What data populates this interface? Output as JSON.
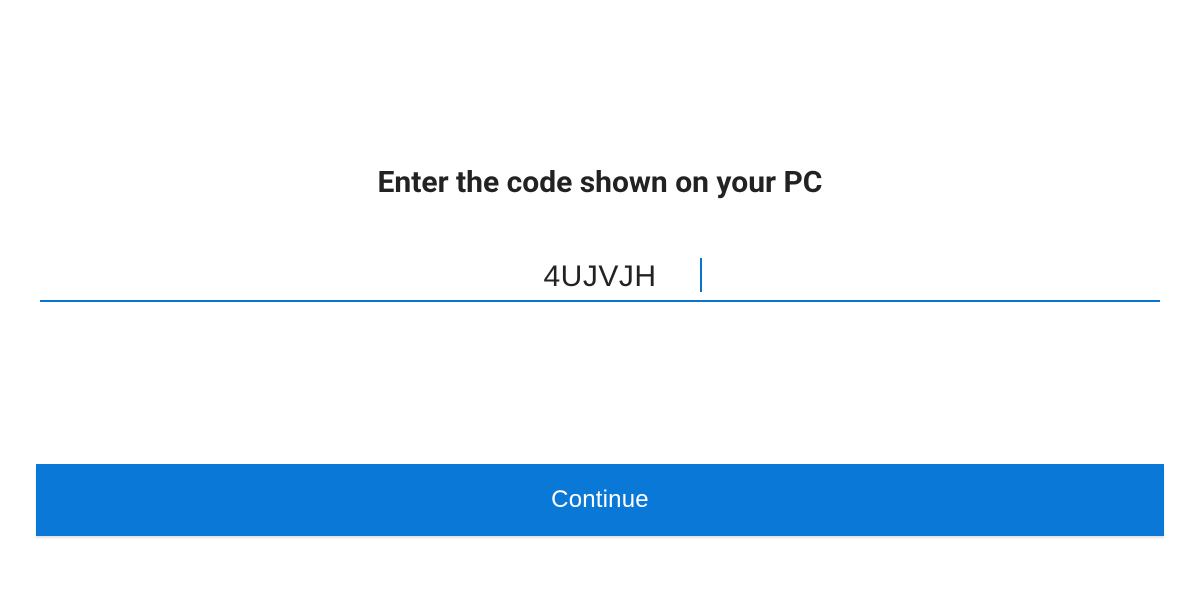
{
  "heading": "Enter the code shown on your PC",
  "code_input_value": "4UJVJH",
  "continue_label": "Continue",
  "colors": {
    "accent": "#0a78d6",
    "underline": "#0a73d0"
  }
}
